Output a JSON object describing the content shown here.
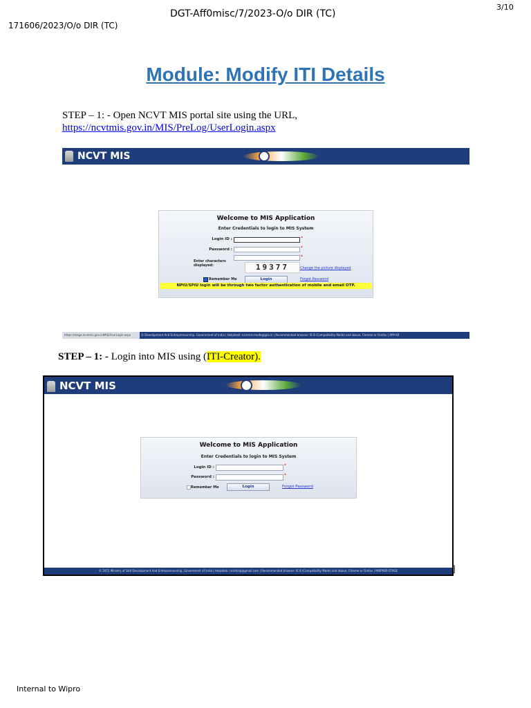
{
  "header": {
    "page_number": "3/10",
    "doc_ref_top": "DGT-Aff0misc/7/2023-O/o DIR (TC)",
    "doc_ref_side": "171606/2023/O/o DIR (TC)"
  },
  "title": "Module: Modify ITI Details",
  "step1": {
    "text": "STEP – 1: - Open NCVT MIS portal site using   the URL,",
    "url": "https://ncvtmis.gov.in/MIS/PreLog/UserLogin.aspx"
  },
  "screenshot1": {
    "brand": "NCVT MIS",
    "welcome": "Welcome to MIS Application",
    "subtitle": "Enter Credentials to login to MIS System",
    "login_label": "Login ID :",
    "password_label": "Password :",
    "captcha_label": "Enter characters displayed:",
    "captcha": "19377",
    "change_picture": "Change the picture displayed",
    "remember": "Remember Me",
    "login_button": "Login",
    "forgot": "Forgot Password",
    "notice": "NPIU/SPIU login will be through two factor authentication of mobile and email OTP.",
    "status_url": "https://stage.ncvtmis.gov.in/MIS/UserLogin.aspx",
    "footer": "© Development And Entrepreneurship, Government of India | Helpdesk: ncvtmis-mode@gov.in | Recommended browser: IE 8 (Compatibility Mode) and above, Chrome or Firefox | APP-AR"
  },
  "step2": {
    "prefix": "STEP – 1: - ",
    "text": "Login into MIS using (",
    "highlight": "ITI-Creator).",
    "bracket": "]"
  },
  "screenshot2": {
    "brand": "NCVT MIS",
    "welcome": "Welcome to MIS Application",
    "subtitle": "Enter Credentials to login to MIS System",
    "login_label": "Login ID :",
    "password_label": "Password :",
    "remember": "Remember Me",
    "login_button": "Login",
    "forgot": "Forgot Password",
    "footer": "© 2015 Ministry of Skill Development And Entrepreneurship, Government of India | Helpdesk: ncvthelp@gmail.com | Recommended browser: IE 8 (Compatibility Mode) and above, Chrome or Firefox | MISPRER-STAGE"
  },
  "footer_label": "Internal to Wipro",
  "colors": {
    "title": "#2e74b5",
    "banner": "#1f3d7a",
    "highlight": "#ffff00",
    "notice": "#ffff3a"
  }
}
